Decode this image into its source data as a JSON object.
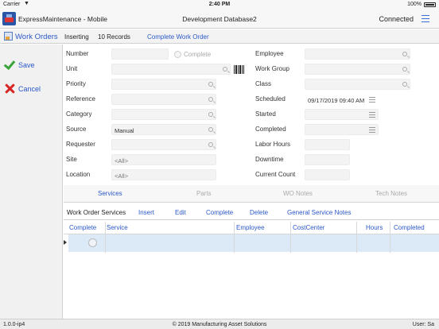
{
  "status_bar": {
    "carrier": "Carrier",
    "time": "2:40 PM",
    "battery": "100%"
  },
  "title_bar": {
    "app_title": "ExpressMaintenance - Mobile",
    "database": "Development Database2",
    "connection": "Connected"
  },
  "toolbar": {
    "module": "Work Orders",
    "mode": "Inserting",
    "records": "10 Records",
    "complete_action": "Complete Work Order"
  },
  "sidebar": {
    "save": "Save",
    "cancel": "Cancel"
  },
  "form": {
    "left": {
      "number": {
        "label": "Number",
        "value": ""
      },
      "complete": {
        "label": "Complete"
      },
      "unit": {
        "label": "Unit",
        "value": ""
      },
      "priority": {
        "label": "Priority",
        "value": ""
      },
      "reference": {
        "label": "Reference",
        "value": ""
      },
      "category": {
        "label": "Category",
        "value": ""
      },
      "source": {
        "label": "Source",
        "value": "Manual"
      },
      "requester": {
        "label": "Requester",
        "value": ""
      },
      "site": {
        "label": "Site",
        "value": "<All>"
      },
      "location": {
        "label": "Location",
        "value": "<All>"
      }
    },
    "right": {
      "employee": {
        "label": "Employee",
        "value": ""
      },
      "work_group": {
        "label": "Work Group",
        "value": ""
      },
      "class": {
        "label": "Class",
        "value": ""
      },
      "scheduled": {
        "label": "Scheduled",
        "value": "09/17/2019 09:40 AM"
      },
      "started": {
        "label": "Started",
        "value": ""
      },
      "completed": {
        "label": "Completed",
        "value": ""
      },
      "labor_hours": {
        "label": "Labor Hours",
        "value": ""
      },
      "downtime": {
        "label": "Downtime",
        "value": ""
      },
      "current_count": {
        "label": "Current Count",
        "value": ""
      }
    }
  },
  "sub_tabs": [
    "Services",
    "Parts",
    "WO Notes",
    "Tech Notes"
  ],
  "services": {
    "title": "Work Order Services",
    "actions": [
      "Insert",
      "Edit",
      "Complete",
      "Delete",
      "General Service Notes"
    ],
    "columns": [
      "Complete",
      "Service",
      "Employee",
      "CostCenter",
      "Hours",
      "Completed"
    ]
  },
  "footer": {
    "version": "1.0.0-ip4",
    "copyright": "© 2019 Manufacturing Asset Solutions",
    "user": "User: Sa"
  },
  "colors": {
    "accent": "#2a58c7",
    "save_check": "#3aa43a",
    "cancel_x": "#d82525",
    "selected_row": "#dce9f6"
  }
}
